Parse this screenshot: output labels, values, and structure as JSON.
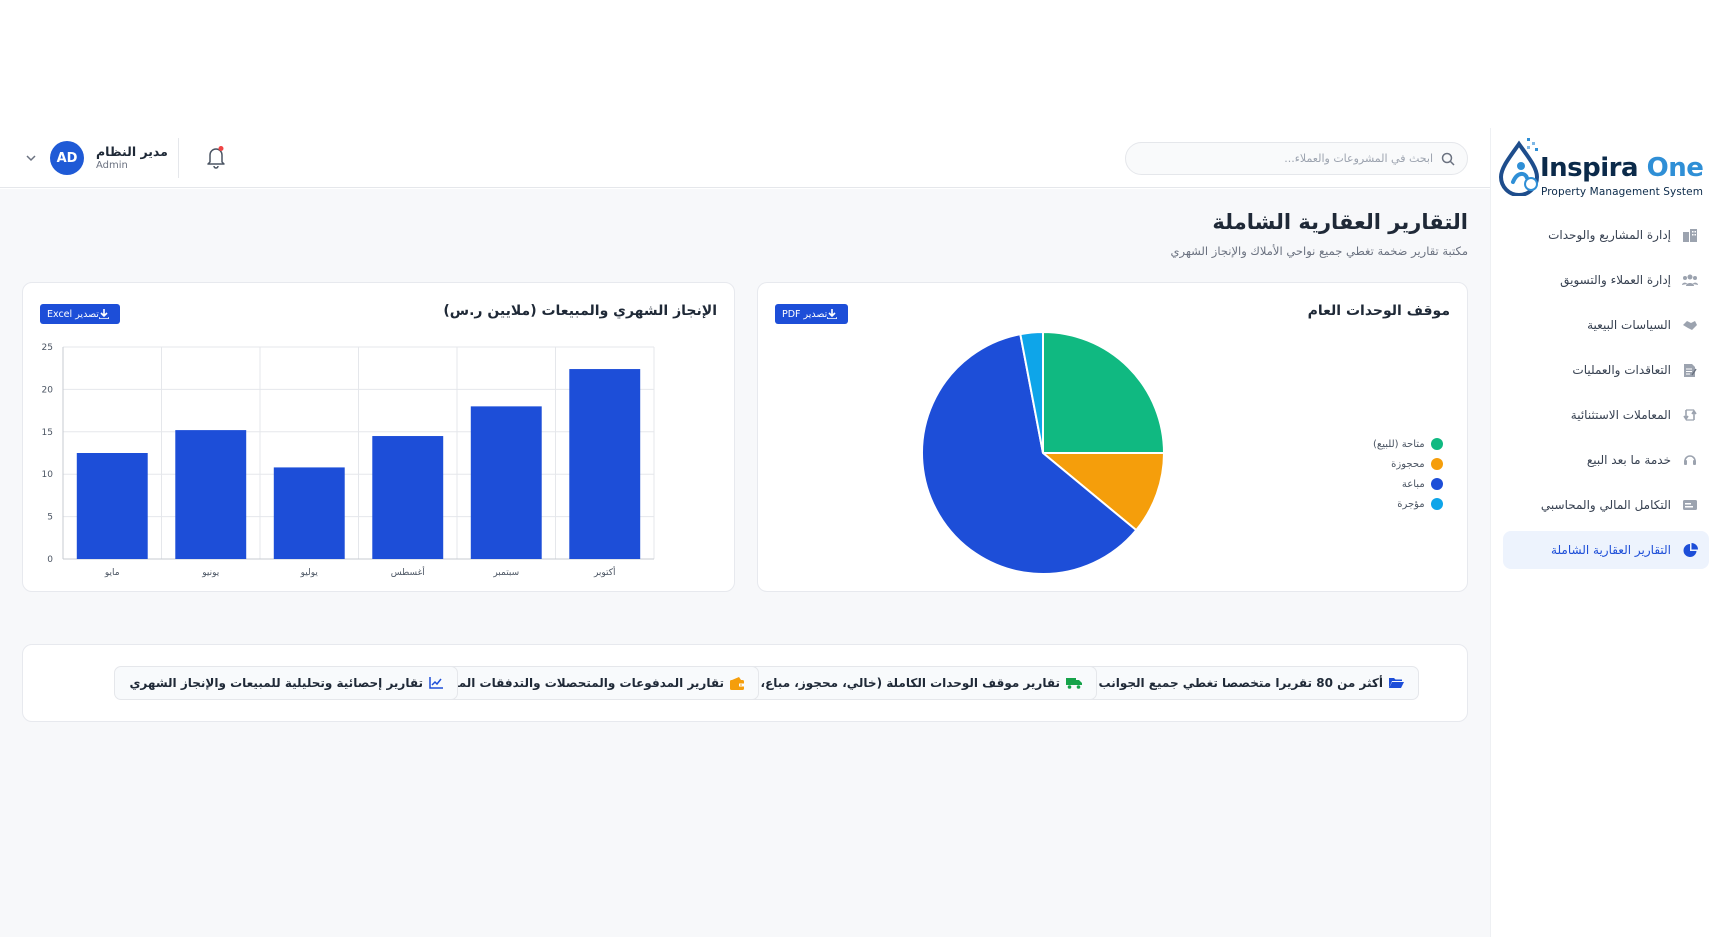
{
  "header": {
    "search_placeholder": "ابحث في المشروعات والعملاء...",
    "user_name": "مدير النظام",
    "user_role": "Admin",
    "avatar_initials": "AD",
    "notification_dot_color": "#ef4444"
  },
  "sidebar": {
    "logo_main": "Inspira",
    "logo_accent": "One",
    "logo_sub": "Property Management System",
    "items": [
      {
        "label": "إدارة المشاريع والوحدات",
        "icon": "building-icon",
        "active": false
      },
      {
        "label": "إدارة العملاء والتسويق",
        "icon": "users-icon",
        "active": false
      },
      {
        "label": "السياسات البيعية",
        "icon": "handshake-icon",
        "active": false
      },
      {
        "label": "التعاقدات والعمليات",
        "icon": "contract-icon",
        "active": false
      },
      {
        "label": "المعاملات الاستثنائية",
        "icon": "exchange-icon",
        "active": false
      },
      {
        "label": "خدمة ما بعد البيع",
        "icon": "headset-icon",
        "active": false
      },
      {
        "label": "التكامل المالي والمحاسبي",
        "icon": "finance-icon",
        "active": false
      },
      {
        "label": "التقارير العقارية الشاملة",
        "icon": "pie-icon",
        "active": true
      }
    ]
  },
  "page": {
    "title": "التقارير العقارية الشاملة",
    "subtitle": "مكتبة تقارير ضخمة تغطي جميع نواحي الأملاك والإنجاز الشهري"
  },
  "bar_card": {
    "title": "الإنجاز الشهري والمبيعات (ملايين ر.س)",
    "export_label": "تصدير Excel"
  },
  "pie_card": {
    "title": "موقف الوحدات العام",
    "export_label": "تصدير PDF"
  },
  "links": [
    {
      "label": "أكثر من 80 تقريرا متخصصا تغطي جميع الجوانب",
      "icon": "folder-open-icon",
      "icon_color": "#1d4ed8"
    },
    {
      "label": "تقارير موقف الوحدات الكاملة (خالي، محجوز، مباع، مؤجر)",
      "icon": "truck-icon",
      "icon_color": "#16a34a"
    },
    {
      "label": "تقارير المدفوعات والمتحصلات والتدفقات المالية",
      "icon": "wallet-icon",
      "icon_color": "#f59e0b"
    },
    {
      "label": "تقارير إحصائية وتحليلية للمبيعات والإنجاز الشهري",
      "icon": "line-chart-icon",
      "icon_color": "#1d4ed8"
    }
  ],
  "colors": {
    "primary": "#1d4ed8",
    "bar": "#1d4ed8"
  },
  "chart_data": [
    {
      "type": "bar",
      "categories": [
        "مايو",
        "يونيو",
        "يوليو",
        "أغسطس",
        "سبتمبر",
        "أكتوبر"
      ],
      "values": [
        12.5,
        15.2,
        10.8,
        14.5,
        18,
        22.4
      ],
      "ylim": [
        0,
        25
      ],
      "yticks": [
        0,
        5,
        10,
        15,
        20,
        25
      ],
      "grid": true,
      "colors": [
        "#1d4ed8"
      ]
    },
    {
      "type": "pie",
      "labels": [
        "متاحة (للبيع)",
        "محجوزة",
        "مباعة",
        "مؤجرة"
      ],
      "values": [
        25,
        11,
        61,
        3
      ],
      "colors": [
        "#10b981",
        "#f59e0b",
        "#1d4ed8",
        "#0ea5e9"
      ],
      "legend": "right"
    }
  ]
}
